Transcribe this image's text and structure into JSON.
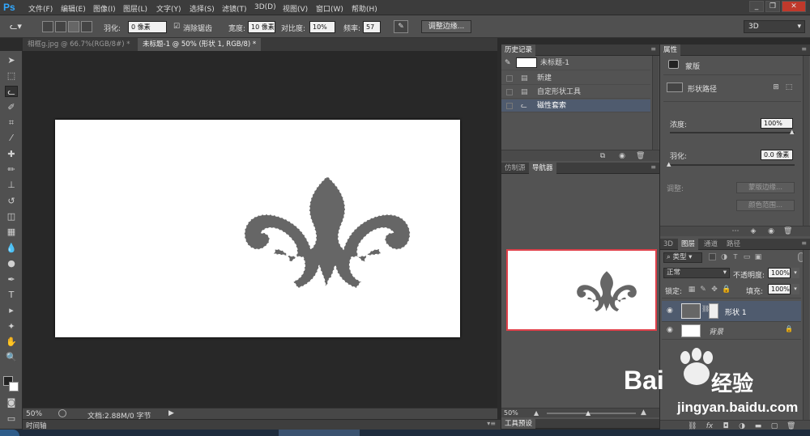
{
  "menubar": {
    "logo": "Ps",
    "items": [
      "文件(F)",
      "编辑(E)",
      "图像(I)",
      "图层(L)",
      "文字(Y)",
      "选择(S)",
      "滤镜(T)",
      "3D(D)",
      "视图(V)",
      "窗口(W)",
      "帮助(H)"
    ],
    "window_buttons": [
      "_",
      "❐",
      "✕"
    ]
  },
  "options": {
    "feather_label": "羽化:",
    "feather_value": "0 像素",
    "antialias_label": "消除锯齿",
    "width_label": "宽度:",
    "width_value": "10 像素",
    "contrast_label": "对比度:",
    "contrast_value": "10%",
    "frequency_label": "频率:",
    "frequency_value": "57",
    "refine_edge": "调整边缘...",
    "workspace": "3D"
  },
  "tabs": [
    {
      "label": "相框g.jpg @ 66.7%(RGB/8#) *"
    },
    {
      "label": "未标题-1 @ 50% (形状 1, RGB/8) *"
    }
  ],
  "status": {
    "zoom": "50%",
    "doc_info": "文档:2.88M/0 字节"
  },
  "timeline": {
    "label": "时间轴"
  },
  "history": {
    "title": "历史记录",
    "snapshot_label": "未标题-1",
    "items": [
      "新建",
      "自定形状工具",
      "磁性套索"
    ]
  },
  "navigator": {
    "tabs": [
      "仿制源",
      "导航器"
    ],
    "zoom": "50%"
  },
  "tool_presets": {
    "label": "工具预设"
  },
  "properties": {
    "title": "属性",
    "mask_label": "蒙版",
    "vector_mask_label": "形状路径",
    "density_label": "浓度:",
    "density_value": "100%",
    "feather_label": "羽化:",
    "feather_value": "0.0 像素",
    "adjust_label": "调整:",
    "mask_edge_btn": "蒙版边缘...",
    "color_range_btn": "颜色范围..."
  },
  "layers": {
    "tabs": [
      "3D",
      "图层",
      "通道",
      "路径"
    ],
    "filter_kind": "类型",
    "blend_mode": "正常",
    "opacity_label": "不透明度:",
    "opacity_value": "100%",
    "lock_label": "锁定:",
    "fill_label": "填充:",
    "fill_value": "100%",
    "items": [
      {
        "name": "形状 1",
        "selected": true
      },
      {
        "name": "背景",
        "selected": false
      }
    ],
    "footer_icons": [
      "link-icon",
      "fx-icon",
      "mask-icon",
      "adjustment-icon",
      "folder-icon",
      "new-layer-icon",
      "trash-icon"
    ]
  },
  "watermark": {
    "brand": "Bai",
    "brand_cn": "经验",
    "url": "jingyan.baidu.com"
  },
  "colors": {
    "accent_selected": "#4f5b6e",
    "shape_fill": "#666666",
    "navigator_frame": "#e0404a"
  }
}
